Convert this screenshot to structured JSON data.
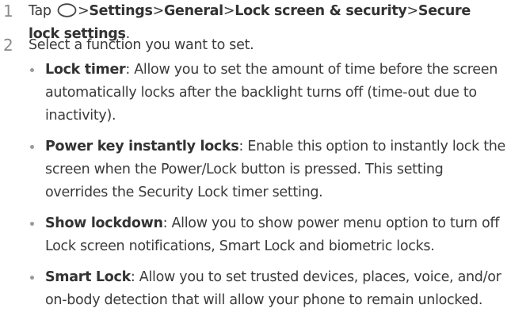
{
  "steps": [
    {
      "number": "1",
      "tap_word": "Tap",
      "home_icon": "home-button-icon",
      "separator": ">",
      "path": [
        "Settings",
        "General",
        "Lock screen & security",
        "Secure lock settings"
      ],
      "end_punct": "."
    },
    {
      "number": "2",
      "text": "Select a function you want to set."
    }
  ],
  "options": [
    {
      "term": "Lock timer",
      "description": ": Allow you to set the amount of time before the screen automatically locks after the backlight turns off (time-out due to inactivity)."
    },
    {
      "term": "Power key instantly locks",
      "description": ": Enable this option to instantly lock the screen when the Power/Lock button is pressed. This setting overrides the Security Lock timer setting."
    },
    {
      "term": "Show lockdown",
      "description": ": Allow you to show power menu option to turn off Lock screen notifications, Smart Lock and biometric locks."
    },
    {
      "term": "Smart Lock",
      "description": ": Allow you to set trusted devices, places, voice, and/or on-body detection that will allow your phone to remain unlocked."
    }
  ]
}
